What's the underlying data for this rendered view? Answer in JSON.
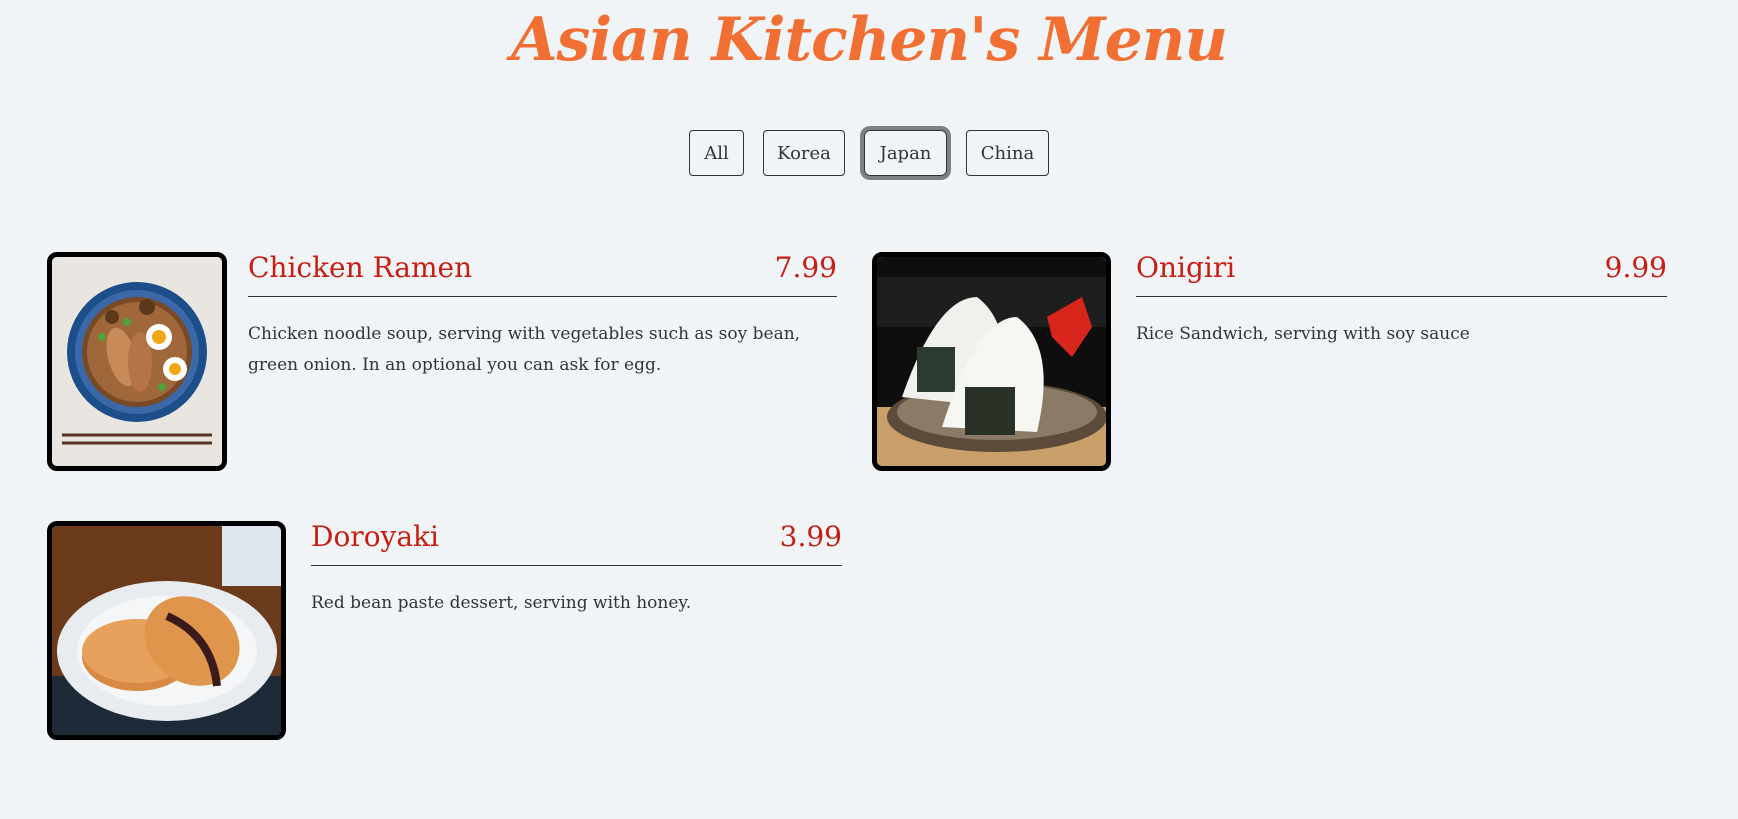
{
  "header": {
    "title": "Asian Kitchen's Menu"
  },
  "filters": {
    "buttons": [
      "All",
      "Korea",
      "Japan",
      "China"
    ],
    "active": "Japan"
  },
  "menu": {
    "items": [
      {
        "name": "Chicken Ramen",
        "price": "7.99",
        "description": "Chicken noodle soup, serving with vegetables such as soy bean, green onion. In an optional you can ask for egg.",
        "image": "ramen-photo"
      },
      {
        "name": "Onigiri",
        "price": "9.99",
        "description": "Rice Sandwich, serving with soy sauce",
        "image": "onigiri-photo"
      },
      {
        "name": "Doroyaki",
        "price": "3.99",
        "description": "Red bean paste dessert, serving with honey.",
        "image": "dorayaki-photo"
      }
    ]
  },
  "colors": {
    "background": "#f0f4f7",
    "title": "#f26f33",
    "item_heading": "#c81d11",
    "text": "#333333",
    "active_ring": "#7a8288"
  }
}
